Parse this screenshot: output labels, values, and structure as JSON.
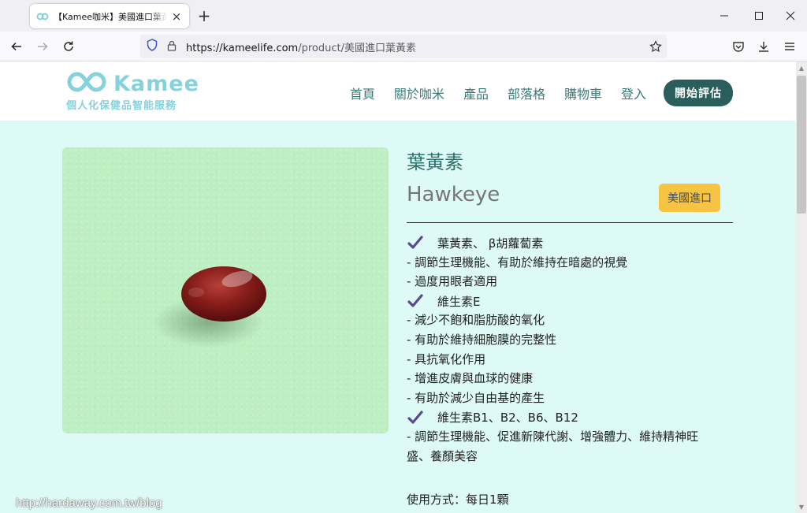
{
  "browser": {
    "tab_title": "【Kamee咖米】美國進口葉黃素",
    "url_host": "https://kameelife.com",
    "url_path": "/product/美國進口葉黃素"
  },
  "site": {
    "logo_word": "Kamee",
    "logo_tagline": "個人化保健品智能服務",
    "menu": [
      "首頁",
      "關於咖米",
      "產品",
      "部落格",
      "購物車",
      "登入"
    ],
    "cta": "開始評估"
  },
  "product": {
    "name_zh": "葉黃素",
    "name_en": "Hawkeye",
    "badge": "美國進口",
    "feature_groups": [
      {
        "title": "葉黃素、 β胡蘿蔔素",
        "lines": [
          "- 調節生理機能、有助於維持在暗處的視覺",
          "- 過度用眼者適用"
        ]
      },
      {
        "title": "維生素E",
        "lines": [
          "- 減少不飽和脂肪酸的氧化",
          "- 有助於維持細胞膜的完整性",
          "- 具抗氧化作用",
          "- 增進皮膚與血球的健康",
          "- 有助於減少自由基的產生"
        ]
      },
      {
        "title": "維生素B1、B2、B6、B12",
        "lines": [
          "- 調節生理機能、促進新陳代謝、增強體力、維持精神旺",
          "盛、養顏美容"
        ]
      }
    ],
    "usage": "使用方式：每日1顆"
  },
  "watermark": "http://hardaway.com.tw/blog",
  "colors": {
    "page_bg": "#defaf6",
    "accent_dark": "#2a5e5c",
    "logo": "#86d2dc",
    "badge": "#f6c342",
    "check": "#5b4a8b",
    "image_bg": "#bdefc2"
  }
}
